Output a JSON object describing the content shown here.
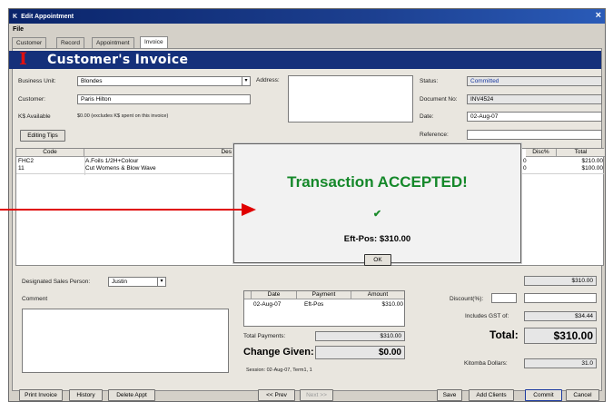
{
  "window": {
    "title": "Edit Appointment",
    "app_badge": "K",
    "close": "×"
  },
  "menu": {
    "file": "File"
  },
  "tabs": [
    {
      "label": "Customer",
      "active": false
    },
    {
      "label": "Record",
      "active": false
    },
    {
      "label": "Appointment",
      "active": false
    },
    {
      "label": "Invoice",
      "active": true
    }
  ],
  "banner": {
    "title": "Customer's Invoice",
    "logo_letter": "I"
  },
  "form": {
    "business_unit_label": "Business Unit:",
    "business_unit_value": "Blondes",
    "customer_label": "Customer:",
    "customer_value": "Paris Hilton",
    "ks_available_label": "K$ Available",
    "ks_available_value": "$0.00 (excludes K$ spent on this invoice)",
    "editing_tips": "Editing Tips",
    "address_label": "Address:",
    "status_label": "Status:",
    "status_value": "Committed",
    "document_label": "Document No:",
    "document_value": "INV4524",
    "date_label": "Date:",
    "date_value": "02-Aug-07",
    "reference_label": "Reference:",
    "reference_value": ""
  },
  "grid": {
    "columns": [
      "Code",
      "Des",
      "Disc%",
      "Total"
    ],
    "rows": [
      {
        "code": "FHC2",
        "desc": "A.Foils 1/2H+Colour",
        "disc": "0",
        "total": "$210.00"
      },
      {
        "code": "11",
        "desc": "Cut Womens & Blow Wave",
        "disc": "0",
        "total": "$100.00"
      }
    ]
  },
  "lower": {
    "sales_person_label": "Designated Sales Person:",
    "sales_person_value": "Justin",
    "comment_label": "Comment",
    "payments_columns": [
      "Date",
      "Payment",
      "Amount"
    ],
    "payments_rows": [
      {
        "date": "02-Aug-07",
        "type": "Eft-Pos",
        "amount": "$310.00"
      }
    ],
    "total_payments_label": "Total Payments:",
    "total_payments_value": "$310.00",
    "change_label": "Change Given:",
    "change_value": "$0.00",
    "session": "Session: 02-Aug-07, Term1, 1",
    "subtotal_value": "$310.00",
    "discount_label": "Discount(%):",
    "discount_value": "",
    "discount_amount": "",
    "gst_label": "Includes GST of:",
    "gst_value": "$34.44",
    "total_label": "Total:",
    "total_value": "$310.00",
    "kitomba_label": "Kitomba Dollars:",
    "kitomba_value": "31.0"
  },
  "buttons": {
    "print_invoice": "Print Invoice",
    "history": "History",
    "delete_appt": "Delete Appt",
    "prev": "<< Prev",
    "next": "Next >>",
    "save": "Save",
    "add_clients": "Add Clients",
    "commit": "Commit",
    "cancel": "Cancel"
  },
  "overlay": {
    "title": "Transaction ACCEPTED!",
    "check": "✔",
    "amount": "Eft-Pos: $310.00",
    "ok": "OK"
  },
  "colors": {
    "accent": "#15307a",
    "success": "#15882a",
    "arrow": "#e00000"
  }
}
